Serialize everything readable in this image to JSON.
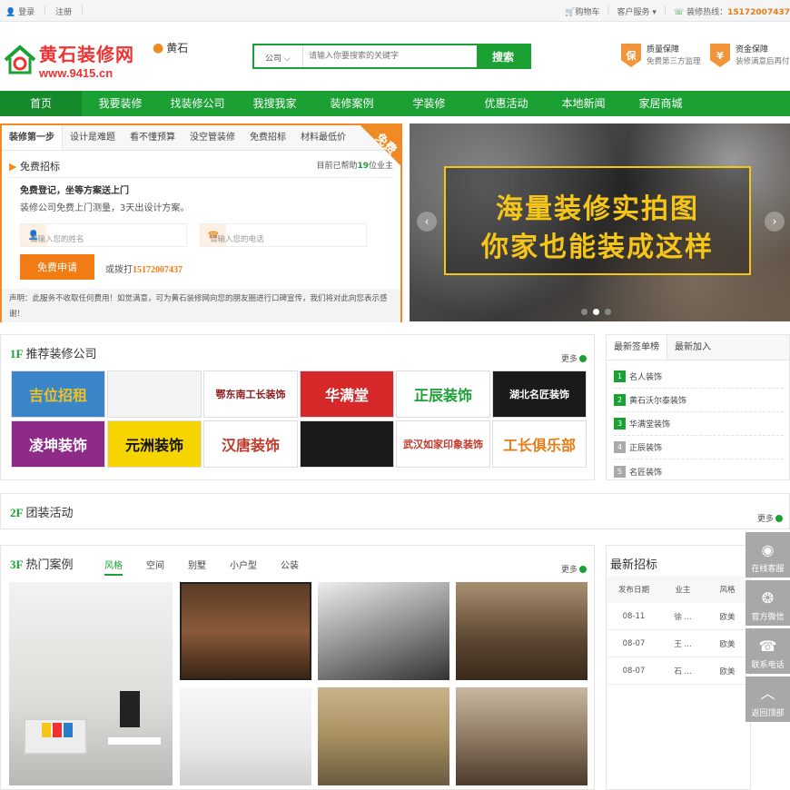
{
  "topbar": {
    "login": "登录",
    "register": "注册",
    "cart": "购物车",
    "service": "客户服务",
    "hotline_label": "装修热线：",
    "hotline": "15172007437"
  },
  "header": {
    "logo_title": "黄石装修网",
    "logo_url": "www.9415.cn",
    "city": "黄石",
    "search_select": "公司",
    "search_placeholder": "请输入你要搜索的关键字",
    "search_button": "搜索",
    "guarantee1_icon": "保",
    "guarantee1_title": "质量保障",
    "guarantee1_sub": "免费第三方监理",
    "guarantee2_icon": "¥",
    "guarantee2_title": "资金保障",
    "guarantee2_sub": "装修满意后再付"
  },
  "nav": [
    "首页",
    "我要装修",
    "找装修公司",
    "我搜我家",
    "装修案例",
    "学装修",
    "优惠活动",
    "本地新闻",
    "家居商城"
  ],
  "register": {
    "tabs": [
      "装修第一步",
      "设计是难题",
      "看不懂预算",
      "没空管装修",
      "免费招标",
      "材料最低价"
    ],
    "corner": "免费",
    "title": "免费招标",
    "helped_pre": "目前已帮助",
    "helped_num": "19",
    "helped_post": "位业主",
    "headline": "免费登记，坐等方案送上门",
    "desc": "装修公司免费上门测量，3天出设计方案。",
    "name_placeholder": "请输入您的姓名",
    "phone_placeholder": "请输入您的电话",
    "apply": "免费申请",
    "call_pre": "或拨打",
    "call_num": "15172007437",
    "note": "声明：此服务不收取任何费用！如觉满意，可为黄石装修网向您的朋友圈进行口碑宣传，我们将对此向您表示感谢！"
  },
  "banner": {
    "line1": "海量装修实拍图",
    "line2": "你家也能装成这样"
  },
  "companies": {
    "floor": "1F",
    "title": "推荐装修公司",
    "more": "更多",
    "logos": [
      "吉位招租",
      "",
      "鄂东南工长装饰",
      "华满堂",
      "正辰装饰",
      "湖北名匠装饰",
      "凌坤装饰",
      "元洲装饰",
      "汉唐装饰",
      "",
      "武汉如家印象装饰",
      "工长俱乐部"
    ],
    "logo_bg": [
      "#3a86c8",
      "#f4f4f4",
      "#ffffff",
      "#d62828",
      "#ffffff",
      "#1a1a1a",
      "#8e2a87",
      "#f5d400",
      "#ffffff",
      "#1a1a1a",
      "#ffffff",
      "#ffffff"
    ],
    "logo_fg": [
      "#f0c020",
      "#333333",
      "#8a1c1c",
      "#ffffff",
      "#1aa033",
      "#ffffff",
      "#ffffff",
      "#111111",
      "#c0392b",
      "#ffffff",
      "#c0392b",
      "#e97b14"
    ]
  },
  "signlist": {
    "tab1": "最新签单榜",
    "tab2": "最新加入",
    "items": [
      "名人装饰",
      "黄石沃尔泰装饰",
      "华满堂装饰",
      "正辰装饰",
      "名匠装饰"
    ],
    "nums": [
      "1",
      "2",
      "3",
      "4",
      "5"
    ]
  },
  "group": {
    "floor": "2F",
    "title": "团装活动",
    "more": "更多"
  },
  "cases": {
    "floor": "3F",
    "title": "热门案例",
    "tabs": [
      "风格",
      "空间",
      "别墅",
      "小户型",
      "公装"
    ],
    "more": "更多"
  },
  "tender": {
    "title": "最新招标",
    "headers": [
      "发布日期",
      "业主",
      "风格"
    ],
    "rows": [
      [
        "08-11",
        "徐 ...",
        "欧美"
      ],
      [
        "08-07",
        "王 ...",
        "欧美"
      ],
      [
        "08-07",
        "石 ...",
        "欧美"
      ]
    ]
  },
  "floatbar": [
    "在线客服",
    "官方微信",
    "联系电话",
    "返回顶部"
  ]
}
